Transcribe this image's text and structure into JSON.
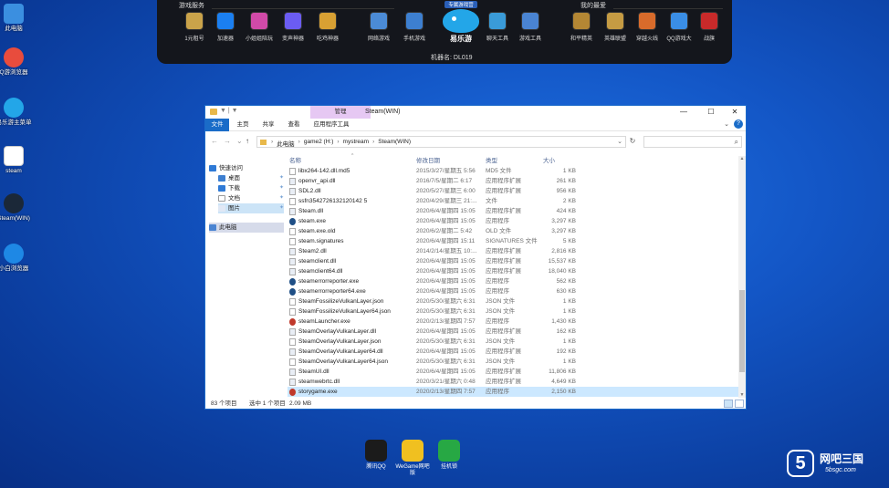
{
  "desktop": {
    "icons": [
      {
        "label": "此电脑",
        "icon": "pc-icon",
        "color": "#3b8fe0"
      },
      {
        "label": "Q游浏览器",
        "icon": "browser-icon",
        "color": "#e84c3d"
      },
      {
        "label": "易乐游主菜单",
        "icon": "fish-icon",
        "color": "#23a6e8"
      },
      {
        "label": "steam",
        "icon": "file-icon",
        "color": "#ffffff"
      },
      {
        "label": "Steam(WIN)",
        "icon": "steam-icon",
        "color": "#1b2838"
      },
      {
        "label": "小白浏览器",
        "icon": "browser-icon",
        "color": "#1e88e5"
      }
    ]
  },
  "launcher": {
    "left_title": "游戏服务",
    "right_title": "我的最爱",
    "ribbon": "专属游戏营",
    "logo_text": "易乐游",
    "machine": "机器名: DL019",
    "left_items": [
      {
        "label": "1元租号",
        "color": "#caa34a"
      },
      {
        "label": "加速器",
        "color": "#1b7ff0"
      },
      {
        "label": "小姐姐陪玩",
        "color": "#d14aa8"
      },
      {
        "label": "变声神器",
        "color": "#6b5cf2"
      },
      {
        "label": "吃鸡神器",
        "color": "#d8a033"
      }
    ],
    "mid_items": [
      {
        "label": "网络游戏",
        "color": "#4b8bd6"
      },
      {
        "label": "手机游戏",
        "color": "#3d7fd0"
      },
      {
        "label": "聊天工具",
        "color": "#3a9bd8"
      },
      {
        "label": "游戏工具",
        "color": "#4a84d2"
      }
    ],
    "right_items": [
      {
        "label": "和平精英",
        "color": "#b48734"
      },
      {
        "label": "英雄联盟",
        "color": "#c59b43"
      },
      {
        "label": "穿越火线",
        "color": "#d86b2b"
      },
      {
        "label": "QQ游戏大",
        "color": "#3a8ee6"
      },
      {
        "label": "战旗",
        "color": "#c82a2a"
      }
    ]
  },
  "window": {
    "title": "Steam(WIN)",
    "context_tab": "管理",
    "quick_access": "▼ | ▼",
    "buttons": {
      "minimize": "—",
      "maximize": "☐",
      "close": "✕"
    },
    "ribbon_tabs": [
      "文件",
      "主页",
      "共享",
      "查看",
      "应用程序工具"
    ],
    "help": "?",
    "nav": {
      "back": "←",
      "forward": "→",
      "recent": "⌄",
      "up": "↑"
    },
    "breadcrumbs": [
      "此电脑",
      "game2 (H:)",
      "mystream",
      "Steam(WIN)"
    ],
    "search_placeholder": "",
    "nav_pane": [
      {
        "label": "快速访问",
        "kind": "star"
      },
      {
        "label": "桌面",
        "kind": "desktop"
      },
      {
        "label": "下载",
        "kind": "download"
      },
      {
        "label": "文档",
        "kind": "doc"
      },
      {
        "label": "图片",
        "kind": "pic"
      },
      {
        "label": "此电脑",
        "kind": "pc"
      }
    ],
    "columns": {
      "name": "名称",
      "date": "修改日期",
      "type": "类型",
      "size": "大小"
    },
    "files": [
      {
        "name": "libx264-142.dll.md5",
        "date": "2015/3/27/星期五 5:56",
        "type": "MD5 文件",
        "size": "1 KB",
        "icon": "file"
      },
      {
        "name": "openvr_api.dll",
        "date": "2016/7/5/星期二 6:17",
        "type": "应用程序扩展",
        "size": "261 KB",
        "icon": "gear"
      },
      {
        "name": "SDL2.dll",
        "date": "2020/5/27/星期三 6:00",
        "type": "应用程序扩展",
        "size": "956 KB",
        "icon": "gear"
      },
      {
        "name": "ssfn3542726132120142 5",
        "date": "2020/4/29/星期三 21:...",
        "type": "文件",
        "size": "2 KB",
        "icon": "file"
      },
      {
        "name": "Steam.dll",
        "date": "2020/6/4/星期四 15:05",
        "type": "应用程序扩展",
        "size": "424 KB",
        "icon": "gear"
      },
      {
        "name": "steam.exe",
        "date": "2020/6/4/星期四 15:05",
        "type": "应用程序",
        "size": "3,297 KB",
        "icon": "exe"
      },
      {
        "name": "steam.exe.old",
        "date": "2020/6/2/星期二 5:42",
        "type": "OLD 文件",
        "size": "3,297 KB",
        "icon": "file"
      },
      {
        "name": "steam.signatures",
        "date": "2020/6/4/星期四 15:11",
        "type": "SIGNATURES 文件",
        "size": "5 KB",
        "icon": "file"
      },
      {
        "name": "Steam2.dll",
        "date": "2014/2/14/星期五 10:...",
        "type": "应用程序扩展",
        "size": "2,816 KB",
        "icon": "gear"
      },
      {
        "name": "steamclient.dll",
        "date": "2020/6/4/星期四 15:05",
        "type": "应用程序扩展",
        "size": "15,537 KB",
        "icon": "gear"
      },
      {
        "name": "steamclient64.dll",
        "date": "2020/6/4/星期四 15:05",
        "type": "应用程序扩展",
        "size": "18,040 KB",
        "icon": "gear"
      },
      {
        "name": "steamerrorreporter.exe",
        "date": "2020/6/4/星期四 15:05",
        "type": "应用程序",
        "size": "562 KB",
        "icon": "exe"
      },
      {
        "name": "steamerrorreporter64.exe",
        "date": "2020/6/4/星期四 15:05",
        "type": "应用程序",
        "size": "630 KB",
        "icon": "exe"
      },
      {
        "name": "SteamFossilizeVulkanLayer.json",
        "date": "2020/5/30/星期六 6:31",
        "type": "JSON 文件",
        "size": "1 KB",
        "icon": "file"
      },
      {
        "name": "SteamFossilizeVulkanLayer64.json",
        "date": "2020/5/30/星期六 6:31",
        "type": "JSON 文件",
        "size": "1 KB",
        "icon": "file"
      },
      {
        "name": "steamLauncher.exe",
        "date": "2020/2/13/星期四 7:57",
        "type": "应用程序",
        "size": "1,430 KB",
        "icon": "red"
      },
      {
        "name": "SteamOverlayVulkanLayer.dll",
        "date": "2020/6/4/星期四 15:05",
        "type": "应用程序扩展",
        "size": "162 KB",
        "icon": "gear"
      },
      {
        "name": "SteamOverlayVulkanLayer.json",
        "date": "2020/5/30/星期六 6:31",
        "type": "JSON 文件",
        "size": "1 KB",
        "icon": "file"
      },
      {
        "name": "SteamOverlayVulkanLayer64.dll",
        "date": "2020/6/4/星期四 15:05",
        "type": "应用程序扩展",
        "size": "192 KB",
        "icon": "gear"
      },
      {
        "name": "SteamOverlayVulkanLayer64.json",
        "date": "2020/5/30/星期六 6:31",
        "type": "JSON 文件",
        "size": "1 KB",
        "icon": "file"
      },
      {
        "name": "SteamUI.dll",
        "date": "2020/6/4/星期四 15:05",
        "type": "应用程序扩展",
        "size": "11,806 KB",
        "icon": "gear"
      },
      {
        "name": "steamwebrtc.dll",
        "date": "2020/3/21/星期六 0:48",
        "type": "应用程序扩展",
        "size": "4,649 KB",
        "icon": "gear"
      },
      {
        "name": "storygame.exe",
        "date": "2020/2/13/星期四 7:57",
        "type": "应用程序",
        "size": "2,150 KB",
        "icon": "red",
        "selected": true
      }
    ],
    "status": {
      "count": "83 个项目",
      "selected": "选中 1 个项目",
      "size": "2.09 MB"
    }
  },
  "dock": [
    {
      "label": "腾讯QQ",
      "color": "#1b1b1b"
    },
    {
      "label": "WeGame网吧版",
      "color": "#f0c020"
    },
    {
      "label": "挂机锁",
      "color": "#27a844"
    }
  ],
  "watermark": {
    "mark": "5",
    "text": "网吧三国",
    "sub": "5bsgc.com"
  }
}
